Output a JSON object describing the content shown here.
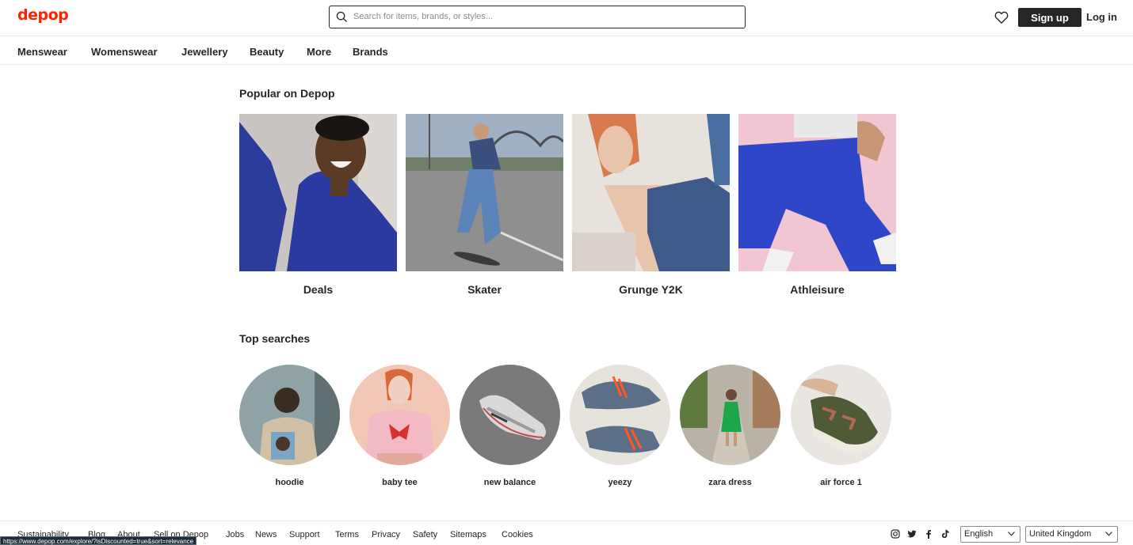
{
  "header": {
    "logo": "depop",
    "search_placeholder": "Search for items, brands, or styles...",
    "signup_label": "Sign up",
    "login_label": "Log in"
  },
  "nav": {
    "items": [
      "Menswear",
      "Womenswear",
      "Jewellery",
      "Beauty",
      "More",
      "Brands"
    ]
  },
  "popular": {
    "title": "Popular on Depop",
    "tiles": [
      {
        "label": "Deals"
      },
      {
        "label": "Skater"
      },
      {
        "label": "Grunge Y2K"
      },
      {
        "label": "Athleisure"
      }
    ]
  },
  "top_searches": {
    "title": "Top searches",
    "items": [
      {
        "label": "hoodie"
      },
      {
        "label": "baby tee"
      },
      {
        "label": "new balance"
      },
      {
        "label": "yeezy"
      },
      {
        "label": "zara dress"
      },
      {
        "label": "air force 1"
      }
    ]
  },
  "footer": {
    "links": [
      "Sustainability",
      "Blog",
      "About",
      "Sell on Depop",
      "Jobs",
      "News",
      "Support",
      "Terms",
      "Privacy",
      "Safety",
      "Sitemaps",
      "Cookies"
    ],
    "social_icons": [
      "instagram-icon",
      "twitter-icon",
      "facebook-icon",
      "tiktok-icon"
    ],
    "language": "English",
    "country": "United Kingdom"
  },
  "status_url": "https://www.depop.com/explore/?isDiscounted=true&sort=relevance",
  "colors": {
    "brand": "#ff2300",
    "text": "#262626",
    "button_bg": "#262626"
  }
}
